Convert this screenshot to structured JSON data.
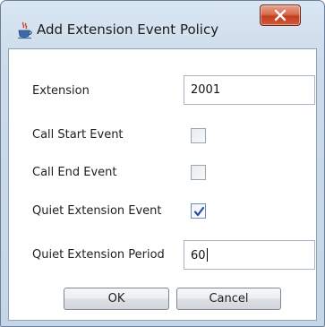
{
  "window": {
    "title": "Add Extension Event Policy"
  },
  "form": {
    "extension_label": "Extension",
    "extension_value": "2001",
    "call_start_label": "Call Start Event",
    "call_start_checked": false,
    "call_end_label": "Call End Event",
    "call_end_checked": false,
    "quiet_event_label": "Quiet Extension Event",
    "quiet_event_checked": true,
    "quiet_period_label": "Quiet Extension Period",
    "quiet_period_value": "60"
  },
  "buttons": {
    "ok_label": "OK",
    "cancel_label": "Cancel"
  },
  "icons": {
    "app": "java-coffee-cup-icon",
    "close": "close-icon",
    "check": "checkmark-icon"
  },
  "colors": {
    "close_button": "#d05a3c",
    "check_mark": "#2a4fa0"
  }
}
